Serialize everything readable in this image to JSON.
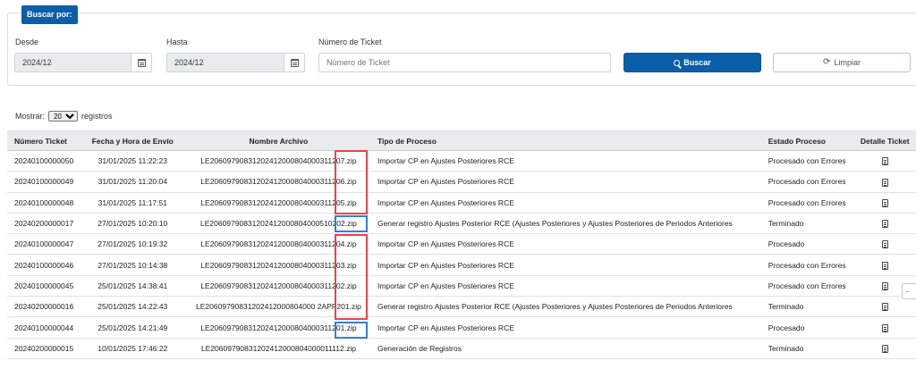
{
  "search": {
    "legend": "Buscar por:",
    "desde_label": "Desde",
    "desde_value": "2024/12",
    "hasta_label": "Hasta",
    "hasta_value": "2024/12",
    "ticket_label": "Número de Ticket",
    "ticket_placeholder": "Número de Ticket",
    "buscar_label": "Buscar",
    "limpiar_label": "Limpiar"
  },
  "entries": {
    "prefix": "Mostrar:",
    "selected": "20",
    "suffix": "registros"
  },
  "table": {
    "headers": {
      "numero": "Número Ticket",
      "fecha": "Fecha y Hora de Envío",
      "archivo": "Nombre Archivo",
      "tipo": "Tipo de Proceso",
      "estado": "Estado Proceso",
      "detalle": "Detalle Ticket"
    },
    "rows": [
      {
        "numero": "20240100000050",
        "fecha": "31/01/2025 11:22:23",
        "archivo": "LE20609790831202412000804000311207.zip",
        "tipo": "Importar CP en Ajustes Posteriores RCE",
        "estado": "Procesado con Errores"
      },
      {
        "numero": "20240100000049",
        "fecha": "31/01/2025 11:20:04",
        "archivo": "LE20609790831202412000804000311206.zip",
        "tipo": "Importar CP en Ajustes Posteriores RCE",
        "estado": "Procesado con Errores"
      },
      {
        "numero": "20240100000048",
        "fecha": "31/01/2025 11:17:51",
        "archivo": "LE20609790831202412000804000311205.zip",
        "tipo": "Importar CP en Ajustes Posteriores RCE",
        "estado": "Procesado con Errores"
      },
      {
        "numero": "20240200000017",
        "fecha": "27/01/2025 10:20:10",
        "archivo": "LE20609790831202412000804000510202.zip",
        "tipo": "Generar registro Ajustes Posterior RCE (Ajustes Posteriores y Ajustes Posteriores de Periodos Anteriores",
        "estado": "Terminado"
      },
      {
        "numero": "20240100000047",
        "fecha": "27/01/2025 10:19:32",
        "archivo": "LE20609790831202412000804000311204.zip",
        "tipo": "Importar CP en Ajustes Posteriores RCE",
        "estado": "Procesado"
      },
      {
        "numero": "20240100000046",
        "fecha": "27/01/2025 10:14:38",
        "archivo": "LE20609790831202412000804000311203.zip",
        "tipo": "Importar CP en Ajustes Posteriores RCE",
        "estado": "Procesado con Errores"
      },
      {
        "numero": "20240100000045",
        "fecha": "25/01/2025 14:38:41",
        "archivo": "LE20609790831202412000804000311202.zip",
        "tipo": "Importar CP en Ajustes Posteriores RCE",
        "estado": "Procesado con Errores"
      },
      {
        "numero": "20240200000016",
        "fecha": "25/01/2025 14:22:43",
        "archivo": "LE20609790831202412000804000 2APP201.zip",
        "tipo": "Generar registro Ajustes Posterior RCE (Ajustes Posteriores y Ajustes Posteriores de Periodos Anteriores",
        "estado": "Terminado"
      },
      {
        "numero": "20240100000044",
        "fecha": "25/01/2025 14:21:49",
        "archivo": "LE20609790831202412000804000311201.zip",
        "tipo": "Importar CP en Ajustes Posteriores RCE",
        "estado": "Procesado"
      },
      {
        "numero": "20240200000015",
        "fecha": "10/01/2025 17:46:22",
        "archivo": "LE20609790831202412000804000011112.zip",
        "tipo": "Generación de Registros",
        "estado": "Terminado"
      }
    ]
  },
  "colors": {
    "primary": "#0b5ea8",
    "highlight_red": "#e8444a",
    "highlight_blue": "#2f7ee0",
    "header_bg": "#e9ecef"
  },
  "icons": [
    "calendar-icon",
    "search-icon",
    "refresh-icon",
    "document-icon"
  ]
}
